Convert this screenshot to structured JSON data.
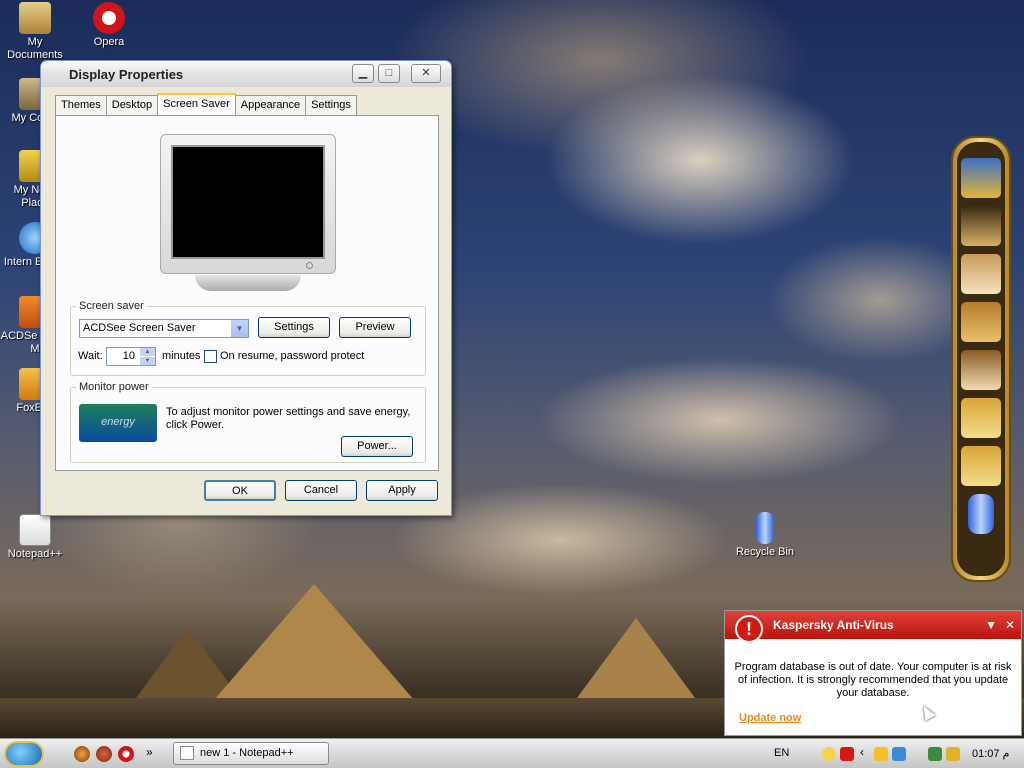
{
  "desktop": {
    "icons": [
      {
        "label": "My Documents"
      },
      {
        "label": "Opera"
      },
      {
        "label": "My Comp"
      },
      {
        "label": "My Netw Place"
      },
      {
        "label": "Intern Explor"
      },
      {
        "label": "ACDSe Photo M"
      },
      {
        "label": "FoxEdit"
      },
      {
        "label": "Notepad++"
      },
      {
        "label": "Recycle Bin"
      }
    ]
  },
  "window": {
    "title": "Display Properties",
    "minimize": "▁",
    "maximize": "□",
    "close": "✕",
    "tabs": [
      "Themes",
      "Desktop",
      "Screen Saver",
      "Appearance",
      "Settings"
    ],
    "active_tab": "Screen Saver",
    "screen_saver": {
      "group_label": "Screen saver",
      "selected": "ACDSee Screen Saver",
      "settings_btn": "Settings",
      "preview_btn": "Preview",
      "wait_label": "Wait:",
      "wait_value": "10",
      "minutes_label": "minutes",
      "password_label": "On resume, password protect",
      "password_checked": false
    },
    "monitor_power": {
      "group_label": "Monitor power",
      "text": "To adjust monitor power settings and save energy, click Power.",
      "power_btn": "Power...",
      "energy_logo": "energy"
    },
    "ok": "OK",
    "cancel": "Cancel",
    "apply": "Apply"
  },
  "notification": {
    "title": "Kaspersky Anti-Virus",
    "icon": "!",
    "body": "Program database is out of date. Your computer is at risk of infection. It is strongly recommended that you update your database.",
    "link": "Update now",
    "menu": "▼",
    "close": "✕"
  },
  "taskbar": {
    "task": "new 1 - Notepad++",
    "lang": "EN",
    "overflow": "»",
    "tray_chevron": "‹",
    "clock": "م 01:07"
  },
  "colors": {
    "accent": "#ffc83c",
    "kav_red": "#d21a12",
    "kav_link": "#e98b1e"
  }
}
